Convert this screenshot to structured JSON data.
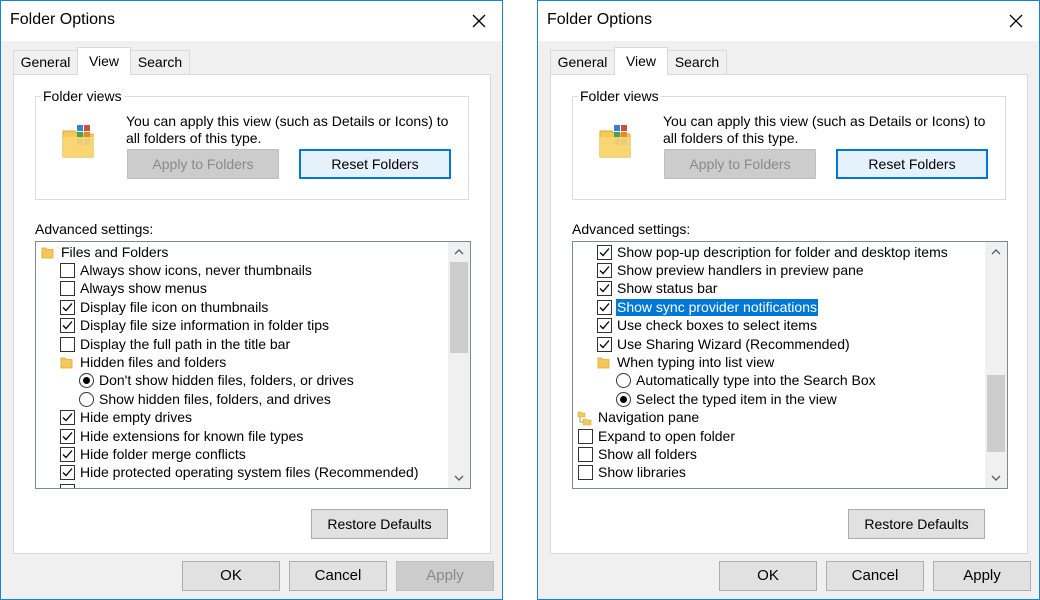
{
  "dialogs": [
    {
      "title": "Folder Options",
      "tabs": [
        "General",
        "View",
        "Search"
      ],
      "active_tab": "View",
      "folder_views": {
        "legend": "Folder views",
        "description": "You can apply this view (such as Details or Icons) to all folders of this type.",
        "apply_label": "Apply to Folders",
        "reset_label": "Reset Folders"
      },
      "advanced_label": "Advanced settings:",
      "scroll_thumb": {
        "start_fraction": 0.0,
        "size_fraction": 0.44
      },
      "rows": [
        {
          "type": "folder",
          "indent": 0,
          "label": "Files and Folders"
        },
        {
          "type": "checkbox",
          "indent": 1,
          "label": "Always show icons, never thumbnails",
          "checked": false
        },
        {
          "type": "checkbox",
          "indent": 1,
          "label": "Always show menus",
          "checked": false
        },
        {
          "type": "checkbox",
          "indent": 1,
          "label": "Display file icon on thumbnails",
          "checked": true
        },
        {
          "type": "checkbox",
          "indent": 1,
          "label": "Display file size information in folder tips",
          "checked": true
        },
        {
          "type": "checkbox",
          "indent": 1,
          "label": "Display the full path in the title bar",
          "checked": false
        },
        {
          "type": "folder",
          "indent": 1,
          "label": "Hidden files and folders"
        },
        {
          "type": "radio",
          "indent": 2,
          "label": "Don't show hidden files, folders, or drives",
          "checked": true
        },
        {
          "type": "radio",
          "indent": 2,
          "label": "Show hidden files, folders, and drives",
          "checked": false
        },
        {
          "type": "checkbox",
          "indent": 1,
          "label": "Hide empty drives",
          "checked": true
        },
        {
          "type": "checkbox",
          "indent": 1,
          "label": "Hide extensions for known file types",
          "checked": true
        },
        {
          "type": "checkbox",
          "indent": 1,
          "label": "Hide folder merge conflicts",
          "checked": true
        },
        {
          "type": "checkbox",
          "indent": 1,
          "label": "Hide protected operating system files (Recommended)",
          "checked": true
        },
        {
          "type": "checkbox",
          "indent": 1,
          "label": "",
          "checked": false,
          "partial": true
        }
      ],
      "restore_label": "Restore Defaults",
      "ok_label": "OK",
      "cancel_label": "Cancel",
      "apply_label": "Apply",
      "apply_enabled": false
    },
    {
      "title": "Folder Options",
      "tabs": [
        "General",
        "View",
        "Search"
      ],
      "active_tab": "View",
      "folder_views": {
        "legend": "Folder views",
        "description": "You can apply this view (such as Details or Icons) to all folders of this type.",
        "apply_label": "Apply to Folders",
        "reset_label": "Reset Folders"
      },
      "advanced_label": "Advanced settings:",
      "scroll_thumb": {
        "start_fraction": 0.55,
        "size_fraction": 0.37
      },
      "rows": [
        {
          "type": "checkbox",
          "indent": 1,
          "label": "Show pop-up description for folder and desktop items",
          "checked": true
        },
        {
          "type": "checkbox",
          "indent": 1,
          "label": "Show preview handlers in preview pane",
          "checked": true
        },
        {
          "type": "checkbox",
          "indent": 1,
          "label": "Show status bar",
          "checked": true
        },
        {
          "type": "checkbox",
          "indent": 1,
          "label": "Show sync provider notifications",
          "checked": true,
          "selected": true
        },
        {
          "type": "checkbox",
          "indent": 1,
          "label": "Use check boxes to select items",
          "checked": true
        },
        {
          "type": "checkbox",
          "indent": 1,
          "label": "Use Sharing Wizard (Recommended)",
          "checked": true
        },
        {
          "type": "folder",
          "indent": 1,
          "label": "When typing into list view"
        },
        {
          "type": "radio",
          "indent": 2,
          "label": "Automatically type into the Search Box",
          "checked": false
        },
        {
          "type": "radio",
          "indent": 2,
          "label": "Select the typed item in the view",
          "checked": true
        },
        {
          "type": "navpane",
          "indent": 0,
          "label": "Navigation pane"
        },
        {
          "type": "checkbox",
          "indent": 0,
          "label": "Expand to open folder",
          "checked": false
        },
        {
          "type": "checkbox",
          "indent": 0,
          "label": "Show all folders",
          "checked": false
        },
        {
          "type": "checkbox",
          "indent": 0,
          "label": "Show libraries",
          "checked": false
        }
      ],
      "restore_label": "Restore Defaults",
      "ok_label": "OK",
      "cancel_label": "Cancel",
      "apply_label": "Apply",
      "apply_enabled": true
    }
  ]
}
